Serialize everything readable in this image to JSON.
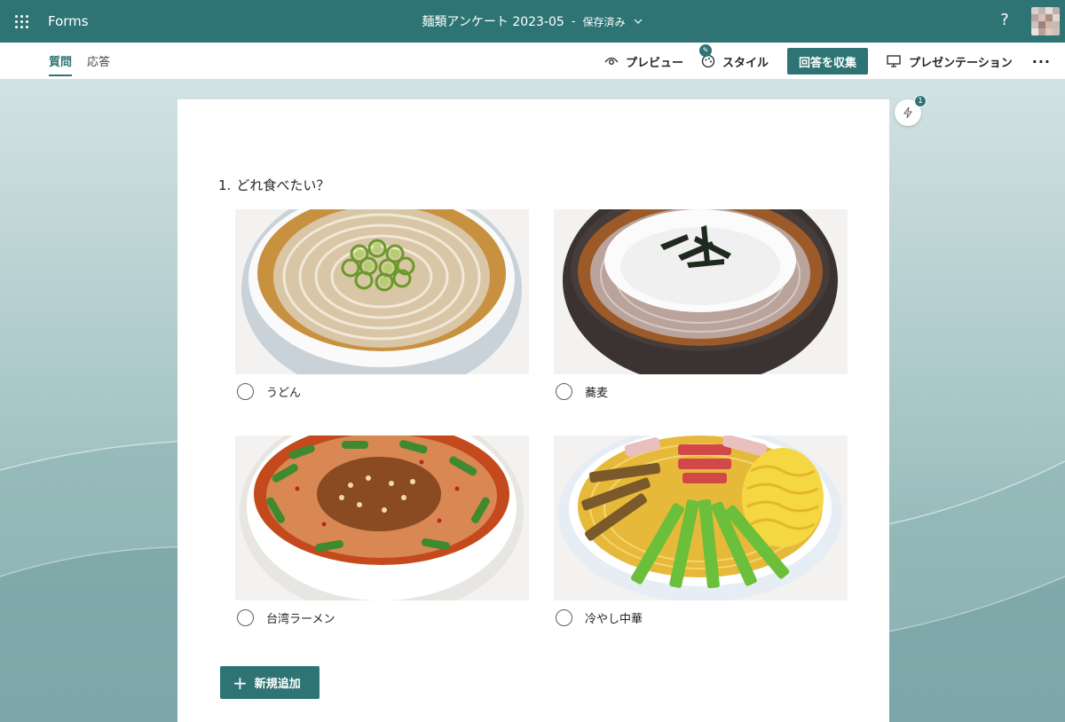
{
  "app": {
    "name": "Forms"
  },
  "header": {
    "form_title": "麺類アンケート 2023-05",
    "separator": "-",
    "save_status": "保存済み",
    "help": "?"
  },
  "tabs": [
    {
      "label": "質問",
      "active": true
    },
    {
      "label": "応答",
      "active": false
    }
  ],
  "commands": {
    "preview": "プレビュー",
    "style": "スタイル",
    "collect": "回答を収集",
    "present": "プレゼンテーション",
    "more": "···"
  },
  "ideas": {
    "badge": "1"
  },
  "question": {
    "number": "1.",
    "text": "どれ食べたい？",
    "options": [
      {
        "label": "うどん",
        "icon": "udon-image"
      },
      {
        "label": "蕎麦",
        "icon": "soba-image"
      },
      {
        "label": "台湾ラーメン",
        "icon": "taiwan-ramen-image"
      },
      {
        "label": "冷やし中華",
        "icon": "hiyashi-chuka-image"
      }
    ]
  },
  "add_new": {
    "label": "新規追加"
  },
  "colors": {
    "theme": "#2e7474",
    "background": "#c9dcdc",
    "card": "#ffffff"
  }
}
